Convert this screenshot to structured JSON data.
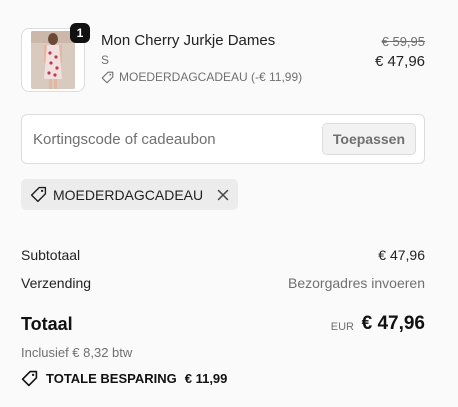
{
  "product": {
    "quantity": "1",
    "title": "Mon Cherry Jurkje Dames",
    "variant": "S",
    "discount_label": "MOEDERDAGCADEAU (-€ 11,99)",
    "price_original": "€ 59,95",
    "price_current": "€ 47,96",
    "thumbnail_icon": "product-photo-dress"
  },
  "discount_form": {
    "placeholder": "Kortingscode of cadeaubon",
    "apply_label": "Toepassen"
  },
  "applied_code": {
    "code": "MOEDERDAGCADEAU",
    "tag_icon": "tag-icon",
    "remove_icon": "close-icon"
  },
  "summary": {
    "subtotal_label": "Subtotaal",
    "subtotal_value": "€ 47,96",
    "shipping_label": "Verzending",
    "shipping_value": "Bezorgadres invoeren",
    "total_label": "Totaal",
    "currency": "EUR",
    "total_value": "€ 47,96",
    "tax_note": "Inclusief € 8,32 btw",
    "savings_label": "TOTALE BESPARING",
    "savings_value": "€ 11,99"
  },
  "colors": {
    "background": "#fafafa",
    "text": "#1f1f1f",
    "muted": "#707070",
    "chip_bg": "#ececec",
    "badge_bg": "#111111"
  }
}
